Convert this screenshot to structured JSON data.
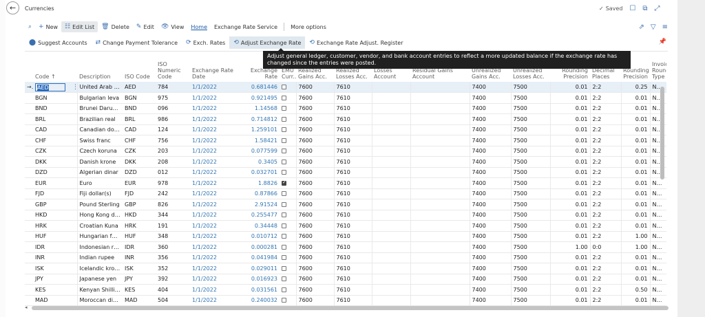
{
  "page": {
    "title": "Currencies",
    "saved_label": "Saved"
  },
  "icons": {
    "back": "←",
    "saved": "✓",
    "bookmark": "☐",
    "open_new": "⧉",
    "collapse": "⤢",
    "new": "+",
    "edit_list": "☷",
    "delete": "🗑",
    "edit": "✎",
    "view": "👁",
    "share": "⇗",
    "filter": "▽",
    "list": "≡",
    "suggest": "⬤",
    "payment": "⇄",
    "rates": "⟳",
    "adjust": "⟲",
    "register": "⟲",
    "pin": "📌",
    "check": "✓",
    "search": "⌕",
    "dots": "⋮",
    "arrow": "→"
  },
  "colors": {
    "accent": "#3175b2",
    "brand": "#1a5aa3",
    "tooltip_bg": "#202020"
  },
  "actionbar": {
    "new": "New",
    "edit_list": "Edit List",
    "delete": "Delete",
    "edit": "Edit",
    "view": "View",
    "home": "Home",
    "exchange_rate_service": "Exchange Rate Service",
    "more_options": "More options"
  },
  "subbar": {
    "suggest_accounts": "Suggest Accounts",
    "change_payment_tolerance": "Change Payment Tolerance",
    "exch_rates": "Exch. Rates",
    "adjust_exchange_rate": "Adjust Exchange Rate",
    "exchange_rate_adjust_register": "Exchange Rate Adjust. Register"
  },
  "tooltip": "Adjust general ledger, customer, vendor, and bank account entries to reflect a more updated balance if the exchange rate has changed since the entries were posted.",
  "columns": {
    "code": "Code ↑",
    "description": "Description",
    "iso_code": "ISO Code",
    "iso_numeric": "ISO Numeric Code",
    "exch_date": "Exchange Rate Date",
    "exch_rate": "Exchange Rate",
    "emu": "EMU Curr...",
    "realized_gains": "Realized Gains Acc.",
    "realized_losses": "Realized Losses Acc.",
    "residual_gains": "Losses Account",
    "residual_losses": "Residual Gains Account",
    "unrealized_gains": "Unrealized Gains Acc.",
    "unrealized_losses": "Unrealized Losses Acc.",
    "amount_rounding": "Rounding Precision",
    "decimal_places": "Decimal Places",
    "invoice_rounding": "Rounding Precision",
    "invoice_rounding_type": "Invoice Rounding Type"
  },
  "rows": [
    {
      "code": "AED",
      "desc": "United Arab Emi...",
      "iso": "AED",
      "num": "784",
      "date": "1/1/2022",
      "rate": "0.681446",
      "emu": false,
      "rg": "7600",
      "rl": "7610",
      "ug": "7400",
      "ul": "7500",
      "ap": "0.01",
      "dp": "2:2",
      "ip": "0.25",
      "it": "Neare"
    },
    {
      "code": "BGN",
      "desc": "Bulgarian leva",
      "iso": "BGN",
      "num": "975",
      "date": "1/1/2022",
      "rate": "0.921495",
      "emu": false,
      "rg": "7600",
      "rl": "7610",
      "ug": "7400",
      "ul": "7500",
      "ap": "0.01",
      "dp": "2:2",
      "ip": "0.01",
      "it": "Neare"
    },
    {
      "code": "BND",
      "desc": "Brunei Darussal...",
      "iso": "BND",
      "num": "096",
      "date": "1/1/2022",
      "rate": "1.14568",
      "emu": false,
      "rg": "7600",
      "rl": "7610",
      "ug": "7400",
      "ul": "7500",
      "ap": "0.01",
      "dp": "2:2",
      "ip": "0.01",
      "it": "Neare"
    },
    {
      "code": "BRL",
      "desc": "Brazilian real",
      "iso": "BRL",
      "num": "986",
      "date": "1/1/2022",
      "rate": "0.714812",
      "emu": false,
      "rg": "7600",
      "rl": "7610",
      "ug": "7400",
      "ul": "7500",
      "ap": "0.01",
      "dp": "2:2",
      "ip": "0.01",
      "it": "Neare"
    },
    {
      "code": "CAD",
      "desc": "Canadian dollar",
      "iso": "CAD",
      "num": "124",
      "date": "1/1/2022",
      "rate": "1.259101",
      "emu": false,
      "rg": "7600",
      "rl": "7610",
      "ug": "7400",
      "ul": "7500",
      "ap": "0.01",
      "dp": "2:2",
      "ip": "0.01",
      "it": "Neare"
    },
    {
      "code": "CHF",
      "desc": "Swiss franc",
      "iso": "CHF",
      "num": "756",
      "date": "1/1/2022",
      "rate": "1.58421",
      "emu": false,
      "rg": "7600",
      "rl": "7610",
      "ug": "7400",
      "ul": "7500",
      "ap": "0.01",
      "dp": "2:2",
      "ip": "0.01",
      "it": "Neare"
    },
    {
      "code": "CZK",
      "desc": "Czech koruna",
      "iso": "CZK",
      "num": "203",
      "date": "1/1/2022",
      "rate": "0.077599",
      "emu": false,
      "rg": "7600",
      "rl": "7610",
      "ug": "7400",
      "ul": "7500",
      "ap": "0.01",
      "dp": "2:2",
      "ip": "0.01",
      "it": "Neare"
    },
    {
      "code": "DKK",
      "desc": "Danish krone",
      "iso": "DKK",
      "num": "208",
      "date": "1/1/2022",
      "rate": "0.3405",
      "emu": false,
      "rg": "7600",
      "rl": "7610",
      "ug": "7400",
      "ul": "7500",
      "ap": "0.01",
      "dp": "2:2",
      "ip": "0.01",
      "it": "Neare"
    },
    {
      "code": "DZD",
      "desc": "Algerian dinar",
      "iso": "DZD",
      "num": "012",
      "date": "1/1/2022",
      "rate": "0.032701",
      "emu": false,
      "rg": "7600",
      "rl": "7610",
      "ug": "7400",
      "ul": "7500",
      "ap": "0.01",
      "dp": "2:2",
      "ip": "0.01",
      "it": "Neare"
    },
    {
      "code": "EUR",
      "desc": "Euro",
      "iso": "EUR",
      "num": "978",
      "date": "1/1/2022",
      "rate": "1.8826",
      "emu": true,
      "rg": "7600",
      "rl": "7610",
      "ug": "7400",
      "ul": "7500",
      "ap": "0.01",
      "dp": "2:2",
      "ip": "0.01",
      "it": "Neare"
    },
    {
      "code": "FJD",
      "desc": "Fiji dollar(s)",
      "iso": "FJD",
      "num": "242",
      "date": "1/1/2022",
      "rate": "0.87866",
      "emu": false,
      "rg": "7600",
      "rl": "7610",
      "ug": "7400",
      "ul": "7500",
      "ap": "0.01",
      "dp": "2:2",
      "ip": "0.01",
      "it": "Neare"
    },
    {
      "code": "GBP",
      "desc": "Pound Sterling",
      "iso": "GBP",
      "num": "826",
      "date": "1/1/2022",
      "rate": "2.91524",
      "emu": false,
      "rg": "7600",
      "rl": "7610",
      "ug": "7400",
      "ul": "7500",
      "ap": "0.01",
      "dp": "2:2",
      "ip": "0.01",
      "it": "Neare"
    },
    {
      "code": "HKD",
      "desc": "Hong Kong doll...",
      "iso": "HKD",
      "num": "344",
      "date": "1/1/2022",
      "rate": "0.255477",
      "emu": false,
      "rg": "7600",
      "rl": "7610",
      "ug": "7400",
      "ul": "7500",
      "ap": "0.01",
      "dp": "2:2",
      "ip": "0.01",
      "it": "Neare"
    },
    {
      "code": "HRK",
      "desc": "Croatian Kuna",
      "iso": "HRK",
      "num": "191",
      "date": "1/1/2022",
      "rate": "0.34448",
      "emu": false,
      "rg": "7600",
      "rl": "7610",
      "ug": "7400",
      "ul": "7500",
      "ap": "0.01",
      "dp": "2:2",
      "ip": "0.01",
      "it": "Neare"
    },
    {
      "code": "HUF",
      "desc": "Hungarian forint",
      "iso": "HUF",
      "num": "348",
      "date": "1/1/2022",
      "rate": "0.010712",
      "emu": false,
      "rg": "7600",
      "rl": "7610",
      "ug": "7400",
      "ul": "7500",
      "ap": "0.01",
      "dp": "2:2",
      "ip": "1.00",
      "it": "Neare"
    },
    {
      "code": "IDR",
      "desc": "Indonesian rupiah",
      "iso": "IDR",
      "num": "360",
      "date": "1/1/2022",
      "rate": "0.000281",
      "emu": false,
      "rg": "7600",
      "rl": "7610",
      "ug": "7400",
      "ul": "7500",
      "ap": "1.00",
      "dp": "0:0",
      "ip": "1.00",
      "it": "Neare"
    },
    {
      "code": "INR",
      "desc": "Indian rupee",
      "iso": "INR",
      "num": "356",
      "date": "1/1/2022",
      "rate": "0.041984",
      "emu": false,
      "rg": "7600",
      "rl": "7610",
      "ug": "7400",
      "ul": "7500",
      "ap": "0.01",
      "dp": "2:2",
      "ip": "0.01",
      "it": "Neare"
    },
    {
      "code": "ISK",
      "desc": "Icelandic krona",
      "iso": "ISK",
      "num": "352",
      "date": "1/1/2022",
      "rate": "0.029011",
      "emu": false,
      "rg": "7600",
      "rl": "7610",
      "ug": "7400",
      "ul": "7500",
      "ap": "0.01",
      "dp": "2:2",
      "ip": "0.01",
      "it": "Neare"
    },
    {
      "code": "JPY",
      "desc": "Japanese yen",
      "iso": "JPY",
      "num": "392",
      "date": "1/1/2022",
      "rate": "0.016923",
      "emu": false,
      "rg": "7600",
      "rl": "7610",
      "ug": "7400",
      "ul": "7500",
      "ap": "0.01",
      "dp": "2:2",
      "ip": "0.01",
      "it": "Neare"
    },
    {
      "code": "KES",
      "desc": "Kenyan Shilling",
      "iso": "KES",
      "num": "404",
      "date": "1/1/2022",
      "rate": "0.031561",
      "emu": false,
      "rg": "7600",
      "rl": "7610",
      "ug": "7400",
      "ul": "7500",
      "ap": "0.01",
      "dp": "2:2",
      "ip": "0.50",
      "it": "Neare"
    },
    {
      "code": "MAD",
      "desc": "Moroccan dirham",
      "iso": "MAD",
      "num": "504",
      "date": "1/1/2022",
      "rate": "0.240032",
      "emu": false,
      "rg": "7600",
      "rl": "7610",
      "ug": "7400",
      "ul": "7500",
      "ap": "0.01",
      "dp": "2:2",
      "ip": "0.01",
      "it": "Neare"
    }
  ]
}
